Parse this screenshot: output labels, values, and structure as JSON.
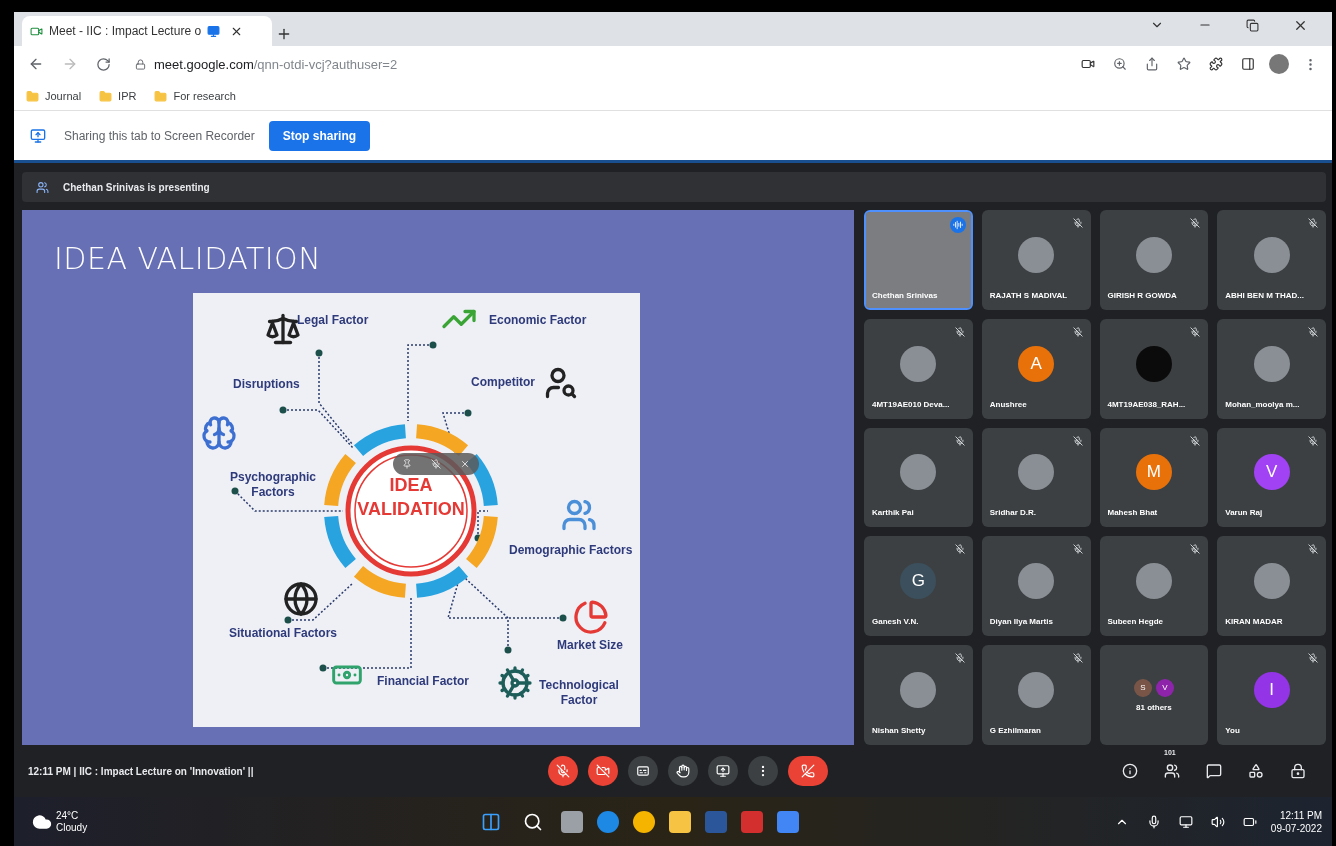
{
  "browser": {
    "tab": {
      "title": "Meet - IIC : Impact Lecture o",
      "recording": true,
      "selected": true
    },
    "address": {
      "domain": "meet.google.com",
      "path": "/qnn-otdi-vcj?authuser=2"
    },
    "bookmarks": [
      "Journal",
      "IPR",
      "For research"
    ]
  },
  "share_bar": {
    "message": "Sharing this tab to Screen Recorder",
    "button": "Stop sharing"
  },
  "presenting_banner": "Chethan Srinivas is presenting",
  "slide": {
    "title": "IDEA VALIDATION",
    "center_lines": [
      "IDEA",
      "VALIDATION"
    ],
    "factors": [
      {
        "kind": "legal",
        "label": "Legal Factor"
      },
      {
        "kind": "economic",
        "label": "Economic Factor"
      },
      {
        "kind": "disruptions",
        "label": "Disruptions"
      },
      {
        "kind": "competitor",
        "label": "Competitor"
      },
      {
        "kind": "psychographic",
        "label": "Psychographic Factors"
      },
      {
        "kind": "demographic",
        "label": "Demographic Factors"
      },
      {
        "kind": "situational",
        "label": "Situational Factors"
      },
      {
        "kind": "market",
        "label": "Market Size"
      },
      {
        "kind": "financial",
        "label": "Financial Factor"
      },
      {
        "kind": "technological",
        "label": "Technological Factor"
      }
    ]
  },
  "participants": [
    {
      "name": "Chethan Srinivas",
      "kind": "video",
      "muted": false,
      "speaking": true
    },
    {
      "name": "RAJATH S MADIVAL",
      "kind": "photo",
      "muted": true,
      "speaking": false
    },
    {
      "name": "GIRISH R GOWDA",
      "kind": "photo",
      "muted": true,
      "speaking": false
    },
    {
      "name": "ABHI BEN M THAD...",
      "kind": "photo",
      "muted": true,
      "speaking": false
    },
    {
      "name": "4MT19AE010 Deva...",
      "kind": "photo",
      "muted": true,
      "speaking": false
    },
    {
      "name": "Anushree",
      "kind": "letter",
      "initial": "A",
      "color": "#e8710a",
      "muted": true,
      "speaking": false
    },
    {
      "name": "4MT19AE038_RAH...",
      "kind": "blank",
      "muted": true,
      "speaking": false
    },
    {
      "name": "Mohan_moolya m...",
      "kind": "photo",
      "muted": true,
      "speaking": false
    },
    {
      "name": "Karthik Pai",
      "kind": "photo",
      "muted": true,
      "speaking": false
    },
    {
      "name": "Sridhar D.R.",
      "kind": "photo",
      "muted": true,
      "speaking": false
    },
    {
      "name": "Mahesh Bhat",
      "kind": "letter",
      "initial": "M",
      "color": "#e8710a",
      "muted": true,
      "speaking": false
    },
    {
      "name": "Varun Raj",
      "kind": "letter",
      "initial": "V",
      "color": "#a142f4",
      "muted": true,
      "speaking": false
    },
    {
      "name": "Ganesh V.N.",
      "kind": "letter",
      "initial": "G",
      "color": "#3c4f5c",
      "muted": true,
      "speaking": false
    },
    {
      "name": "Diyan Ilya Martis",
      "kind": "photo",
      "muted": true,
      "speaking": false
    },
    {
      "name": "Subeen Hegde",
      "kind": "photo",
      "muted": true,
      "speaking": false
    },
    {
      "name": "KIRAN MADAR",
      "kind": "photo",
      "muted": true,
      "speaking": false
    },
    {
      "name": "Nishan Shetty",
      "kind": "photo",
      "muted": true,
      "speaking": false
    },
    {
      "name": "G Ezhilmaran",
      "kind": "photo",
      "muted": true,
      "speaking": false
    },
    {
      "name": "81 others",
      "kind": "others",
      "muted": false,
      "speaking": false,
      "avatars": [
        {
          "initial": "S",
          "color": "#795548"
        },
        {
          "initial": "V",
          "color": "#8e24aa"
        }
      ]
    },
    {
      "name": "You",
      "kind": "letter",
      "initial": "I",
      "color": "#9334e6",
      "muted": true,
      "speaking": false
    }
  ],
  "meeting_bar": {
    "time": "12:11 PM",
    "separator": "|",
    "title": "IIC : Impact Lecture on 'Innovation' ||",
    "controls": [
      {
        "kind": "mic",
        "on": false
      },
      {
        "kind": "camera",
        "on": false
      },
      {
        "kind": "captions"
      },
      {
        "kind": "hand"
      },
      {
        "kind": "present"
      },
      {
        "kind": "more"
      },
      {
        "kind": "end"
      }
    ],
    "people_count": "101"
  },
  "taskbar": {
    "temperature": "24°C",
    "weather": "Cloudy",
    "time": "12:11 PM",
    "date": "09-07-2022"
  }
}
